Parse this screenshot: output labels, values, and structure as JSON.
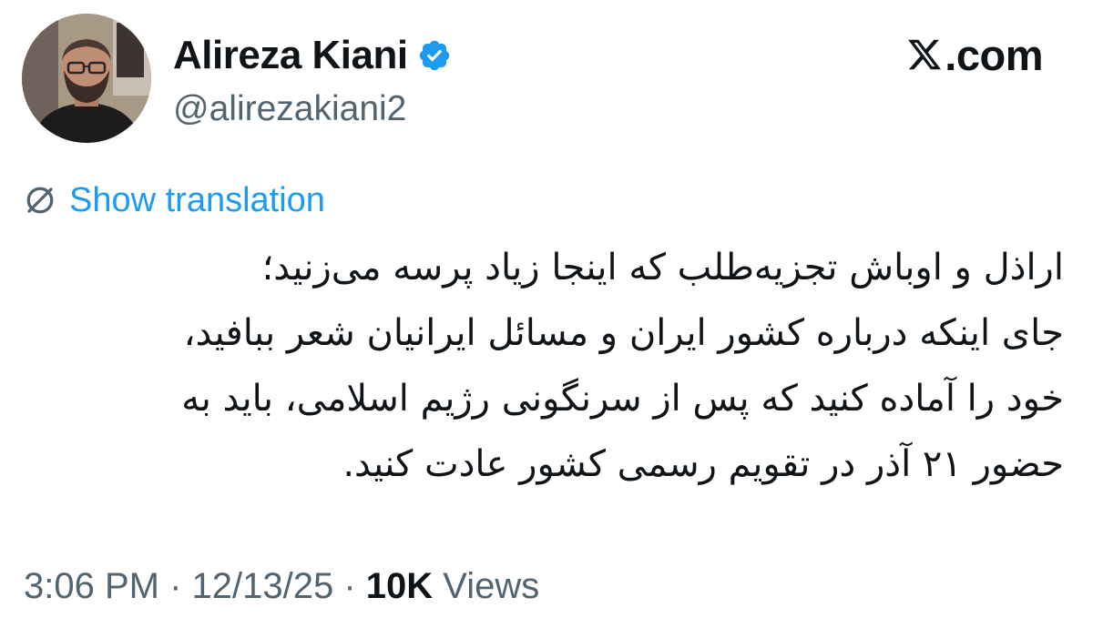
{
  "author": {
    "display_name": "Alireza Kiani",
    "handle": "@alirezakiani2",
    "verified": true,
    "verified_badge_color": "#1d9bf0"
  },
  "brand": {
    "label": ".com",
    "icon": "x-logo-icon"
  },
  "translation": {
    "label": "Show translation",
    "icon": "translate-icon",
    "color": "#1d9bf0"
  },
  "tweet": {
    "lines": [
      "اراذل و اوباش تجزیه‌طلب که اینجا زیاد پرسه می‌زنید؛",
      "جای اینکه درباره کشور ایران و مسائل ایرانیان شعر ببافید،",
      "خود را آماده کنید که پس از سرنگونی رژیم اسلامی، باید به",
      "حضور ۲۱ آذر در تقویم رسمی کشور عادت کنید."
    ]
  },
  "meta": {
    "time": "3:06 PM",
    "separator": " · ",
    "date": "12/13/25",
    "views_count": "10K",
    "views_label": " Views"
  }
}
